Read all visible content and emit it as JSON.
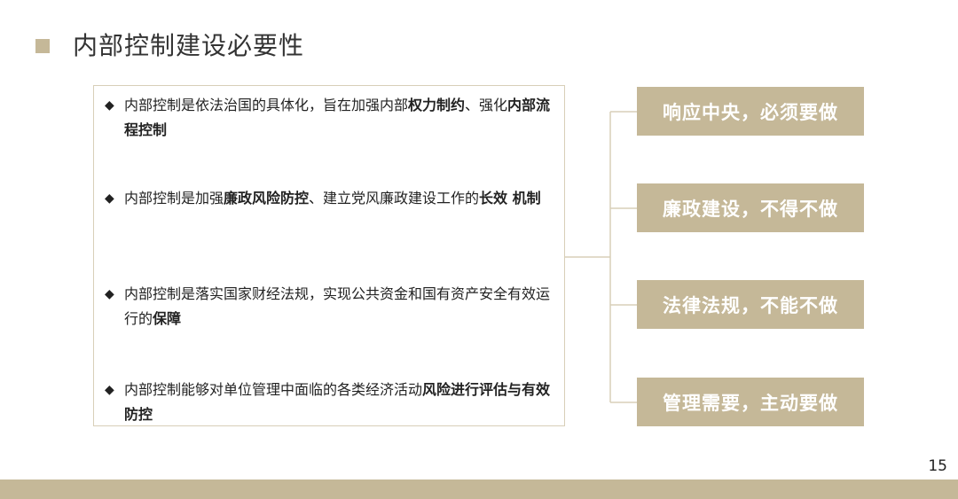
{
  "slide": {
    "title": "内部控制建设必要性",
    "page_number": "15",
    "accent_color": "#c5b898"
  },
  "bullets": [
    {
      "segments": [
        {
          "text": "内部控制是依法治国的具体化，旨在加强内部",
          "bold": false
        },
        {
          "text": "权力制约",
          "bold": true
        },
        {
          "text": "、强化",
          "bold": false
        },
        {
          "text": "内部流程控制",
          "bold": true
        }
      ]
    },
    {
      "segments": [
        {
          "text": "内部控制是加强",
          "bold": false
        },
        {
          "text": "廉政风险防控",
          "bold": true
        },
        {
          "text": "、建立党风廉政建设工作的",
          "bold": false
        },
        {
          "text": "长效 机制",
          "bold": true
        }
      ]
    },
    {
      "segments": [
        {
          "text": "内部控制是落实国家财经法规，实现公共资金和国有资产安全有效运行的",
          "bold": false
        },
        {
          "text": "保障",
          "bold": true
        }
      ]
    },
    {
      "segments": [
        {
          "text": "内部控制能够对单位管理中面临的各类经济活动",
          "bold": false
        },
        {
          "text": "风险进行评估与有效防控",
          "bold": true
        }
      ]
    }
  ],
  "right_buttons": [
    {
      "label": "响应中央，必须要做"
    },
    {
      "label": "廉政建设，不得不做"
    },
    {
      "label": "法律法规，不能不做"
    },
    {
      "label": "管理需要，主动要做"
    }
  ]
}
